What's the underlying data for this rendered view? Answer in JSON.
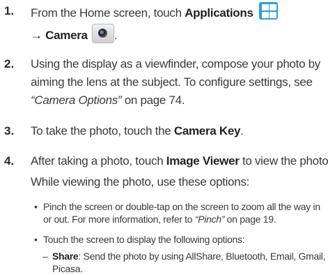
{
  "steps": [
    {
      "number": "1.",
      "line1_text": "From the Home screen, touch ",
      "line1_bold": "Applications",
      "line2_arrow": "→ ",
      "line2_bold": "Camera",
      "line2_end": "."
    },
    {
      "number": "2.",
      "line1": "Using the display as a viewfinder, compose your photo by",
      "line2": "aiming the lens at the subject. To configure settings, see",
      "line3_italic": "“Camera Options”",
      "line3_text": " on page 74."
    },
    {
      "number": "3.",
      "text": "To take the photo, touch the ",
      "bold": "Camera Key",
      "end": "."
    },
    {
      "number": "4.",
      "line1_text": "After taking a photo, touch ",
      "line1_bold": "Image Viewer",
      "line1_end": " to view the photo.",
      "line2": "While viewing the photo, use these options:"
    }
  ],
  "bullets": [
    {
      "symbol": "•",
      "line1": "Pinch the screen or double-tap on the screen to zoom all the way in",
      "line2_text": "or out. For more information, refer to ",
      "line2_italic": "“Pinch”",
      "line2_end": " on page 19."
    },
    {
      "symbol": "•",
      "line1": "Touch the screen to display the following options:"
    }
  ],
  "subitem": {
    "symbol": "–",
    "bold": "Share",
    "line1_text": ": Send the photo by using AllShare, Bluetooth, Email, Gmail, or",
    "line2": "Picasa."
  },
  "icons": {
    "applications": "applications-grid-icon",
    "camera": "camera-icon",
    "applications_color": "#2a9fd6"
  }
}
